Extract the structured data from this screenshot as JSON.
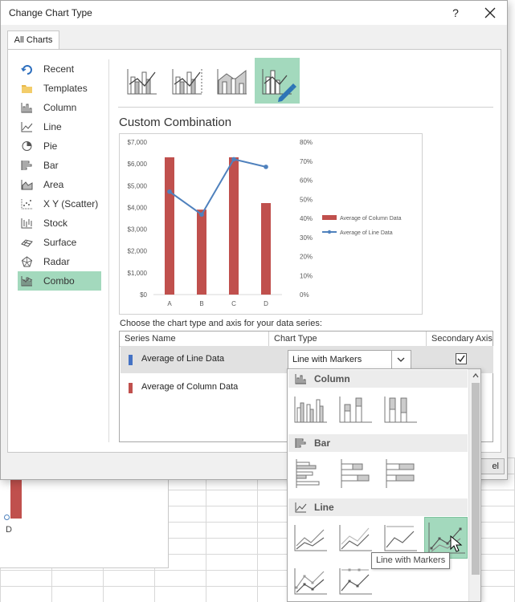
{
  "window": {
    "title": "Change Chart Type",
    "help": "?",
    "close": "✕"
  },
  "tabs": [
    {
      "label": "All Charts"
    }
  ],
  "categories": [
    {
      "label": "Recent",
      "icon": "recent-icon"
    },
    {
      "label": "Templates",
      "icon": "folder-icon"
    },
    {
      "label": "Column",
      "icon": "column-chart-icon"
    },
    {
      "label": "Line",
      "icon": "line-chart-icon"
    },
    {
      "label": "Pie",
      "icon": "pie-chart-icon"
    },
    {
      "label": "Bar",
      "icon": "bar-chart-icon"
    },
    {
      "label": "Area",
      "icon": "area-chart-icon"
    },
    {
      "label": "X Y (Scatter)",
      "icon": "scatter-chart-icon"
    },
    {
      "label": "Stock",
      "icon": "stock-chart-icon"
    },
    {
      "label": "Surface",
      "icon": "surface-chart-icon"
    },
    {
      "label": "Radar",
      "icon": "radar-chart-icon"
    },
    {
      "label": "Combo",
      "icon": "combo-chart-icon",
      "selected": true
    }
  ],
  "section_title": "Custom Combination",
  "choose_label": "Choose the chart type and axis for your data series:",
  "table": {
    "headers": [
      "Series Name",
      "Chart Type",
      "Secondary Axis"
    ],
    "rows": [
      {
        "name": "Average of Line Data",
        "color": "#4472c4",
        "chart_type": "Line with Markers",
        "secondary_axis": true
      },
      {
        "name": "Average of Column Data",
        "color": "#c0504d",
        "chart_type": "",
        "secondary_axis": false
      }
    ]
  },
  "dropdown": {
    "groups": [
      {
        "label": "Column",
        "icon": "column-chart-icon"
      },
      {
        "label": "Bar",
        "icon": "bar-chart-icon"
      },
      {
        "label": "Line",
        "icon": "line-chart-icon"
      }
    ]
  },
  "tooltip": "Line with Markers",
  "button_partial": "el",
  "sheet": {
    "label": "D"
  },
  "chart_data": {
    "type": "combo",
    "categories": [
      "A",
      "B",
      "C",
      "D"
    ],
    "series": [
      {
        "name": "Average of Column Data",
        "type": "bar",
        "axis": "primary",
        "color": "#c0504d",
        "values": [
          6300,
          3900,
          6300,
          4200
        ]
      },
      {
        "name": "Average of Line Data",
        "type": "line",
        "axis": "secondary",
        "color": "#4f81bd",
        "values": [
          0.54,
          0.42,
          0.71,
          0.67
        ]
      }
    ],
    "y_primary": {
      "min": 0,
      "max": 7000,
      "ticks": [
        "$0",
        "$1,000",
        "$2,000",
        "$3,000",
        "$4,000",
        "$5,000",
        "$6,000",
        "$7,000"
      ]
    },
    "y_secondary": {
      "min": 0,
      "max": 0.8,
      "ticks": [
        "0%",
        "10%",
        "20%",
        "30%",
        "40%",
        "50%",
        "60%",
        "70%",
        "80%"
      ]
    },
    "legend": "right"
  }
}
